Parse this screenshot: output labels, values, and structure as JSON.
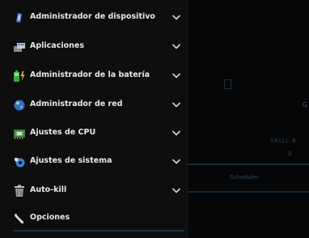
{
  "drawer": {
    "items": [
      {
        "label": "Administrador de dispositivo",
        "icon": "phone-icon",
        "expandable": true
      },
      {
        "label": "Aplicaciones",
        "icon": "apps-icon",
        "expandable": true
      },
      {
        "label": "Administrador de la batería",
        "icon": "battery-icon",
        "expandable": true
      },
      {
        "label": "Administrador de red",
        "icon": "globe-icon",
        "expandable": true
      },
      {
        "label": "Ajustes de CPU",
        "icon": "cpu-icon",
        "expandable": true
      },
      {
        "label": "Ajustes de sistema",
        "icon": "system-settings-icon",
        "expandable": true
      },
      {
        "label": "Auto-kill",
        "icon": "trash-icon",
        "expandable": true
      },
      {
        "label": "Opciones",
        "icon": "wrench-icon",
        "expandable": false
      }
    ]
  },
  "background": {
    "letter": "G",
    "status": "SKILL B",
    "value": "0",
    "tab": "Schedules"
  },
  "colors": {
    "drawer_bg": "#0e0e0f",
    "label": "#e8e8e8",
    "accent_line": "#16364a"
  }
}
